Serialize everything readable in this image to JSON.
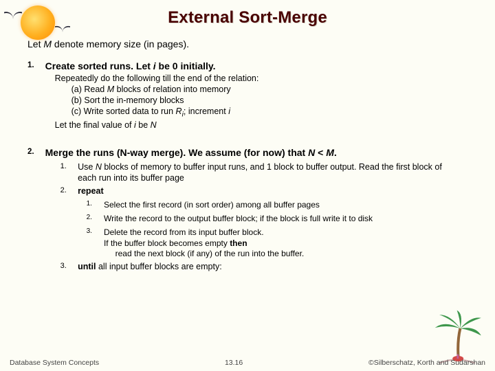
{
  "title": "External Sort-Merge",
  "intro_pre": "Let ",
  "intro_var": "M",
  "intro_post": " denote memory size (in pages).",
  "step1": {
    "num": "1.",
    "head": "Create sorted runs.",
    "tail_pre": "  Let ",
    "tail_var": "i",
    "tail_post": " be 0 initially.",
    "l1": "Repeatedly do the following till the end of the relation:",
    "a_pre": "(a)  Read ",
    "a_var": "M",
    "a_post": " blocks of relation into memory",
    "b": "(b)  Sort the in-memory blocks",
    "c_pre": "(c)  Write sorted data to run ",
    "c_var1": "R",
    "c_sub": "i",
    "c_mid": "; increment ",
    "c_var2": "i",
    "l2_pre": "Let the final value of ",
    "l2_var": "i",
    "l2_mid": " be ",
    "l2_var2": "N"
  },
  "step2": {
    "num": "2.",
    "head": "Merge the runs (N-way merge).",
    "tail_pre": " We assume (for now) that ",
    "tail_var1": "N",
    "tail_mid": " < ",
    "tail_var2": "M",
    "tail_post": ".",
    "s1n": "1.",
    "s1_pre": "Use ",
    "s1_var": "N",
    "s1_post": " blocks of memory to buffer input runs, and 1 block to buffer output. Read the first block of each run into its buffer page",
    "s2n": "2.",
    "s2": "repeat",
    "r1n": "1.",
    "r1": "Select the first record (in sort order) among all buffer pages",
    "r2n": "2.",
    "r2": "Write the record to the output buffer block; if the block is full write it to disk",
    "r3n": "3.",
    "r3a": "Delete the record from its input buffer block.",
    "r3b_pre": "If the buffer block becomes empty ",
    "r3b_bold": "then",
    "r3c": "     read the next block (if any) of the run into the buffer.",
    "s3n": "3.",
    "s3_bold": "until",
    "s3_post": " all input buffer blocks are empty:"
  },
  "footer": {
    "left": "Database System Concepts",
    "center": "13.16",
    "right": "©Silberschatz, Korth and Sudarshan"
  }
}
